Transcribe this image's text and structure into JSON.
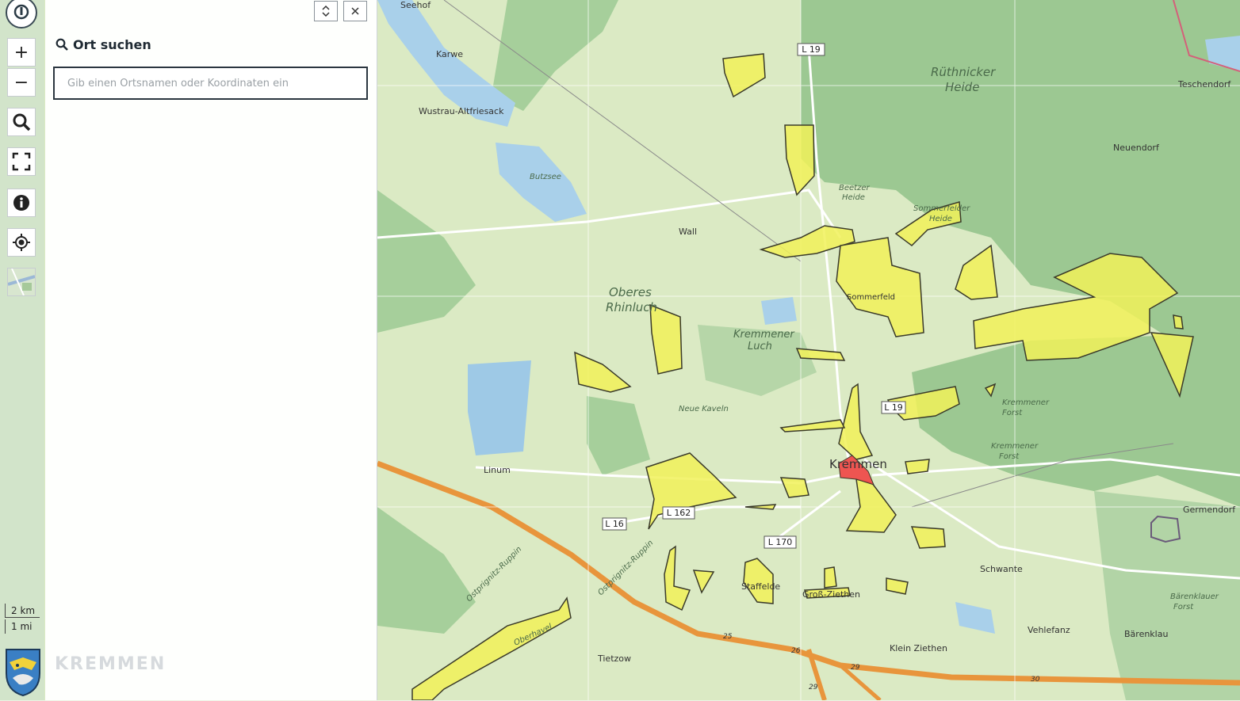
{
  "toolbar": {
    "logo_icon": "map-pin-icon",
    "zoom_in_label": "+",
    "zoom_out_label": "−",
    "search_icon": "search-icon",
    "fullscreen_icon": "fullscreen-icon",
    "info_icon": "info-icon",
    "locate_icon": "crosshair-icon",
    "layer_icon": "layer-thumbnail-icon"
  },
  "scale": {
    "km_label": "2 km",
    "mi_label": "1 mi"
  },
  "panel": {
    "collapse_icon": "collapse-icon",
    "close_icon": "close-icon",
    "title": "Ort suchen",
    "search_placeholder": "Gib einen Ortsnamen oder Koordinaten ein",
    "search_value": ""
  },
  "branding": {
    "name": "KREMMEN"
  },
  "colors": {
    "parcel_fill": "#f1f159",
    "parcel_stroke": "#3a3a2a",
    "highlight_fill": "#f04545",
    "forest": "#9cc892",
    "meadow": "#dbeac4",
    "water": "#a9d0ea",
    "highway": "#e8953c"
  },
  "map": {
    "places": [
      {
        "name": "Seehof",
        "size": 11
      },
      {
        "name": "Karwe",
        "size": 11
      },
      {
        "name": "Wustrau-Altfriesack",
        "size": 11
      },
      {
        "name": "Butzsee",
        "size": 10,
        "italic": true
      },
      {
        "name": "Wall",
        "size": 11
      },
      {
        "name": "Rüthnicker",
        "size": 15,
        "italic": true
      },
      {
        "name": "Heide",
        "size": 15,
        "italic": true
      },
      {
        "name": "Teschendorf",
        "size": 11
      },
      {
        "name": "Neuendorf",
        "size": 11
      },
      {
        "name": "Beetzer",
        "size": 10,
        "italic": true
      },
      {
        "name": "Heide",
        "size": 10,
        "italic": true
      },
      {
        "name": "Sommerfelder",
        "size": 10,
        "italic": true
      },
      {
        "name": "Heide",
        "size": 10,
        "italic": true
      },
      {
        "name": "Sommerfeld",
        "size": 10
      },
      {
        "name": "Oberes",
        "size": 15,
        "italic": true
      },
      {
        "name": "Rhinluch",
        "size": 15,
        "italic": true
      },
      {
        "name": "Kremmener",
        "size": 13,
        "italic": true
      },
      {
        "name": "Luch",
        "size": 13,
        "italic": true
      },
      {
        "name": "Neue Kaveln",
        "size": 10,
        "italic": true
      },
      {
        "name": "Kremmener",
        "size": 10,
        "italic": true
      },
      {
        "name": "Forst",
        "size": 10,
        "italic": true
      },
      {
        "name": "Kremmener",
        "size": 10,
        "italic": true
      },
      {
        "name": "Forst",
        "size": 10,
        "italic": true
      },
      {
        "name": "Linum",
        "size": 11
      },
      {
        "name": "Kremmen",
        "size": 15
      },
      {
        "name": "Germendorf",
        "size": 11
      },
      {
        "name": "Schwante",
        "size": 11
      },
      {
        "name": "Staffelde",
        "size": 11
      },
      {
        "name": "Groß-Ziethen",
        "size": 11
      },
      {
        "name": "Bärenklauer",
        "size": 10,
        "italic": true
      },
      {
        "name": "Forst",
        "size": 10,
        "italic": true
      },
      {
        "name": "Vehlefanz",
        "size": 11
      },
      {
        "name": "Bärenklau",
        "size": 11
      },
      {
        "name": "Klein Ziethen",
        "size": 11
      },
      {
        "name": "Tietzow",
        "size": 11
      },
      {
        "name": "Oberhavel",
        "size": 10,
        "italic": true
      },
      {
        "name": "Ostprignitz-Ruppin",
        "size": 10,
        "italic": true
      },
      {
        "name": "Ostprignitz-Ruppin",
        "size": 10,
        "italic": true
      }
    ],
    "road_labels": [
      "L 19",
      "L 19",
      "L 16",
      "L 162",
      "L 170"
    ],
    "highway_labels": [
      "25",
      "26",
      "29",
      "29",
      "30"
    ]
  }
}
